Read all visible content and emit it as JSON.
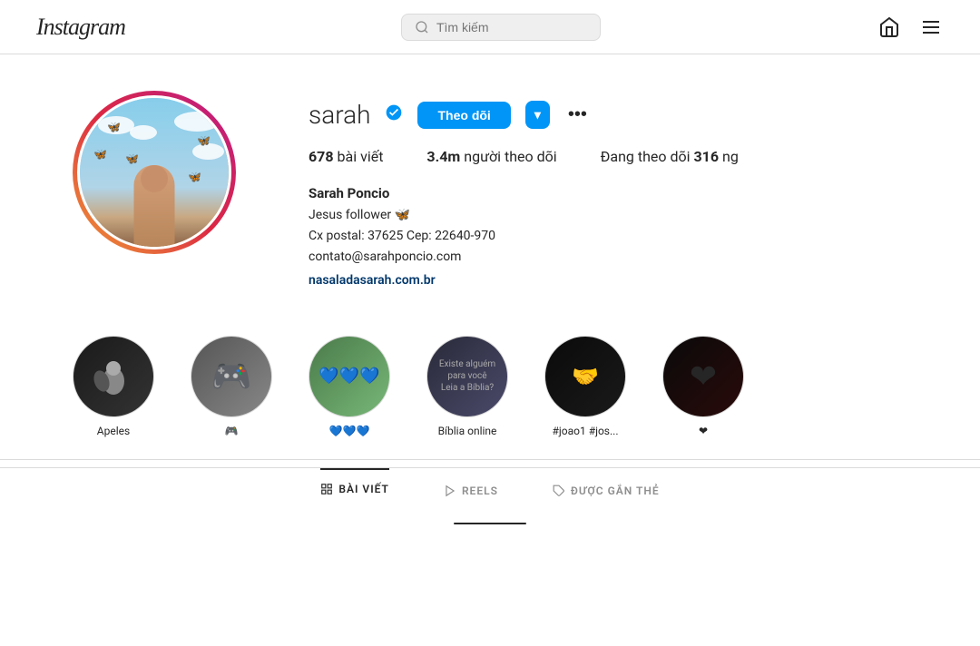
{
  "header": {
    "logo": "Instagram",
    "search_placeholder": "Tìm kiếm"
  },
  "profile": {
    "username": "sarah",
    "verified": true,
    "verified_symbol": "✓",
    "btn_follow": "Theo dõi",
    "btn_dropdown_symbol": "▾",
    "btn_more_symbol": "•••",
    "stats": {
      "posts_count": "678",
      "posts_label": "bài viết",
      "followers_count": "3.4m",
      "followers_label": "người theo dõi",
      "following_prefix": "Đang theo dõi",
      "following_count": "316",
      "following_suffix": "ng"
    },
    "bio": {
      "name": "Sarah Poncio",
      "line1": "Jesus follower 🦋",
      "line2": "Cx postal: 37625 Cep: 22640-970",
      "line3": "contato@sarahponcio.com",
      "link": "nasaladasarah.com.br"
    }
  },
  "highlights": [
    {
      "id": "h1",
      "label": "Apeles",
      "emoji": ""
    },
    {
      "id": "h2",
      "label": "🎮",
      "emoji": "🎮"
    },
    {
      "id": "h3",
      "label": "💙💙💙",
      "emoji": "💙💙💙"
    },
    {
      "id": "h4",
      "label": "Bíblia online",
      "emoji": ""
    },
    {
      "id": "h5",
      "label": "#joao1 #jos...",
      "emoji": ""
    },
    {
      "id": "h6",
      "label": "❤",
      "emoji": "❤"
    }
  ],
  "tabs": {
    "active": "posts",
    "items": [
      {
        "id": "posts",
        "label": "BÀI VIẾT",
        "icon": "grid"
      },
      {
        "id": "reels",
        "label": "REELS",
        "icon": "video"
      },
      {
        "id": "tagged",
        "label": "ĐƯỢC GẮN THẺ",
        "icon": "tag"
      }
    ]
  }
}
